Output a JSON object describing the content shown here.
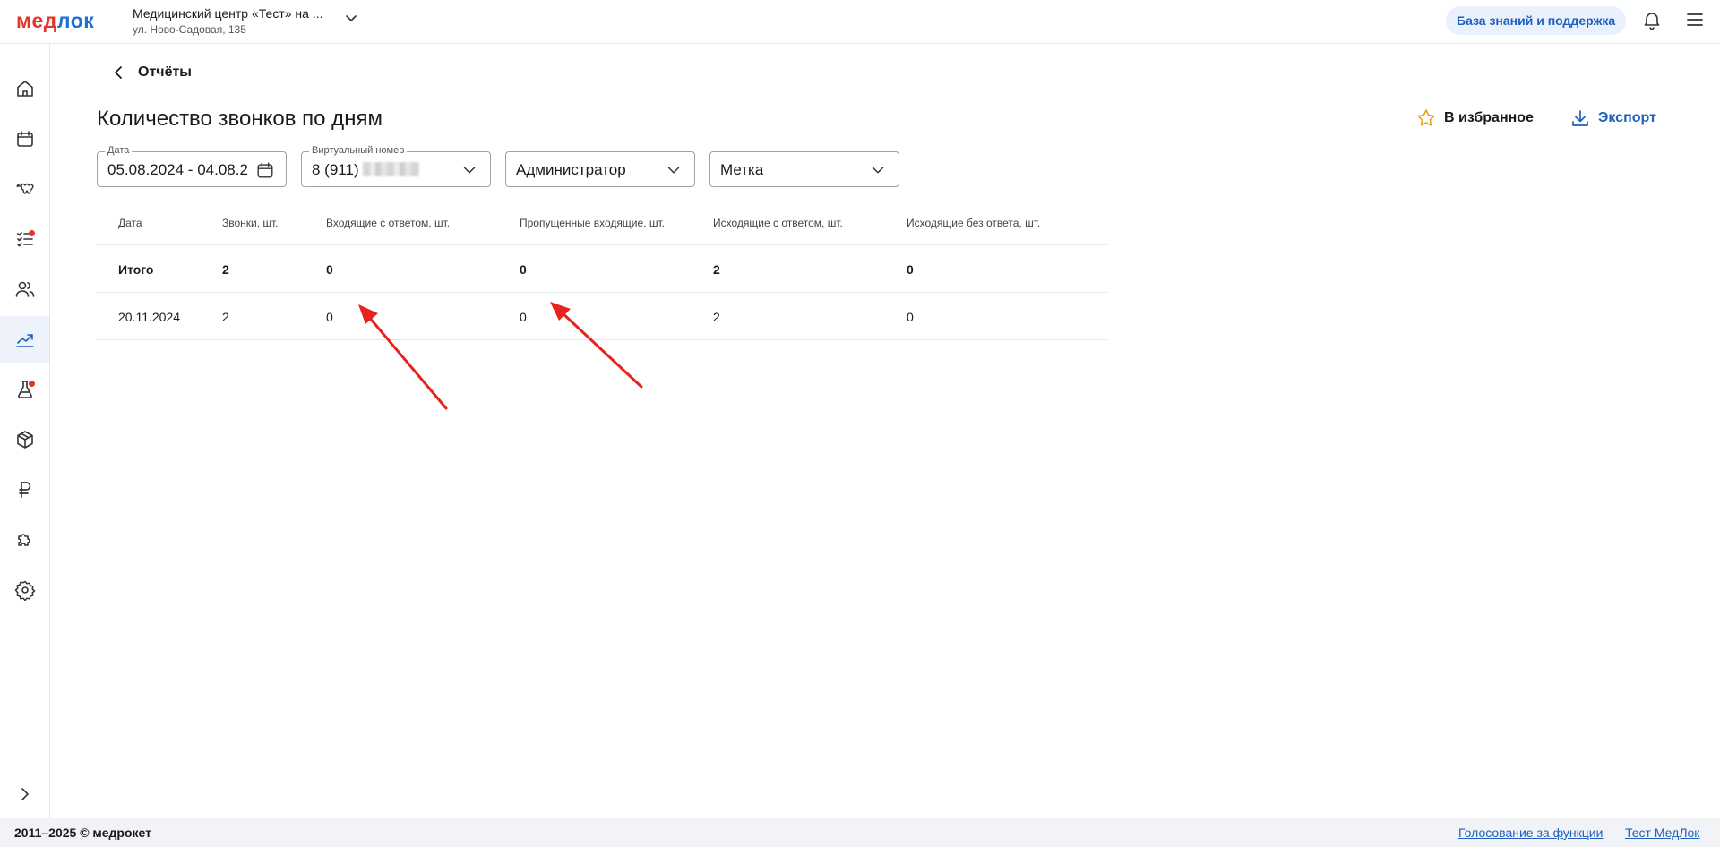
{
  "header": {
    "logo_part1": "мед",
    "logo_part2": "лок",
    "clinic_name": "Медицинский центр «Тест» на ...",
    "clinic_address": "ул. Ново-Садовая, 135",
    "kb_button": "База знаний и поддержка"
  },
  "sidebar": {
    "items": [
      {
        "icon": "home-icon"
      },
      {
        "icon": "calendar-icon"
      },
      {
        "icon": "tooth-icon"
      },
      {
        "icon": "tasks-icon",
        "badge": true
      },
      {
        "icon": "users-icon"
      },
      {
        "icon": "chart-icon",
        "active": true
      },
      {
        "icon": "flask-icon",
        "badge": true
      },
      {
        "icon": "box-icon"
      },
      {
        "icon": "ruble-icon"
      },
      {
        "icon": "puzzle-icon"
      },
      {
        "icon": "settings-icon"
      }
    ]
  },
  "page": {
    "back_label": "Отчёты",
    "title": "Количество звонков по дням",
    "favorite_label": "В избранное",
    "export_label": "Экспорт"
  },
  "filters": {
    "date_label": "Дата",
    "date_value": "05.08.2024 - 04.08.2",
    "number_label": "Виртуальный номер",
    "number_value": "8 (911)",
    "role_value": "Администратор",
    "tag_value": "Метка"
  },
  "table": {
    "columns": [
      "Дата",
      "Звонки, шт.",
      "Входящие с ответом, шт.",
      "Пропущенные входящие, шт.",
      "Исходящие с ответом, шт.",
      "Исходящие без ответа, шт."
    ],
    "total": [
      "Итого",
      "2",
      "0",
      "0",
      "2",
      "0"
    ],
    "rows": [
      [
        "20.11.2024",
        "2",
        "0",
        "0",
        "2",
        "0"
      ]
    ]
  },
  "colors": {
    "accent": "#1f5fbf",
    "logo_red": "#e8332a",
    "logo_blue": "#1f6fd6",
    "favorite_star": "#f0a020",
    "annotation_arrow": "#e8231e"
  },
  "footer": {
    "copyright": "2011–2025 © медрокет",
    "link_vote": "Голосование за функции",
    "link_test": "Тест МедЛок"
  }
}
